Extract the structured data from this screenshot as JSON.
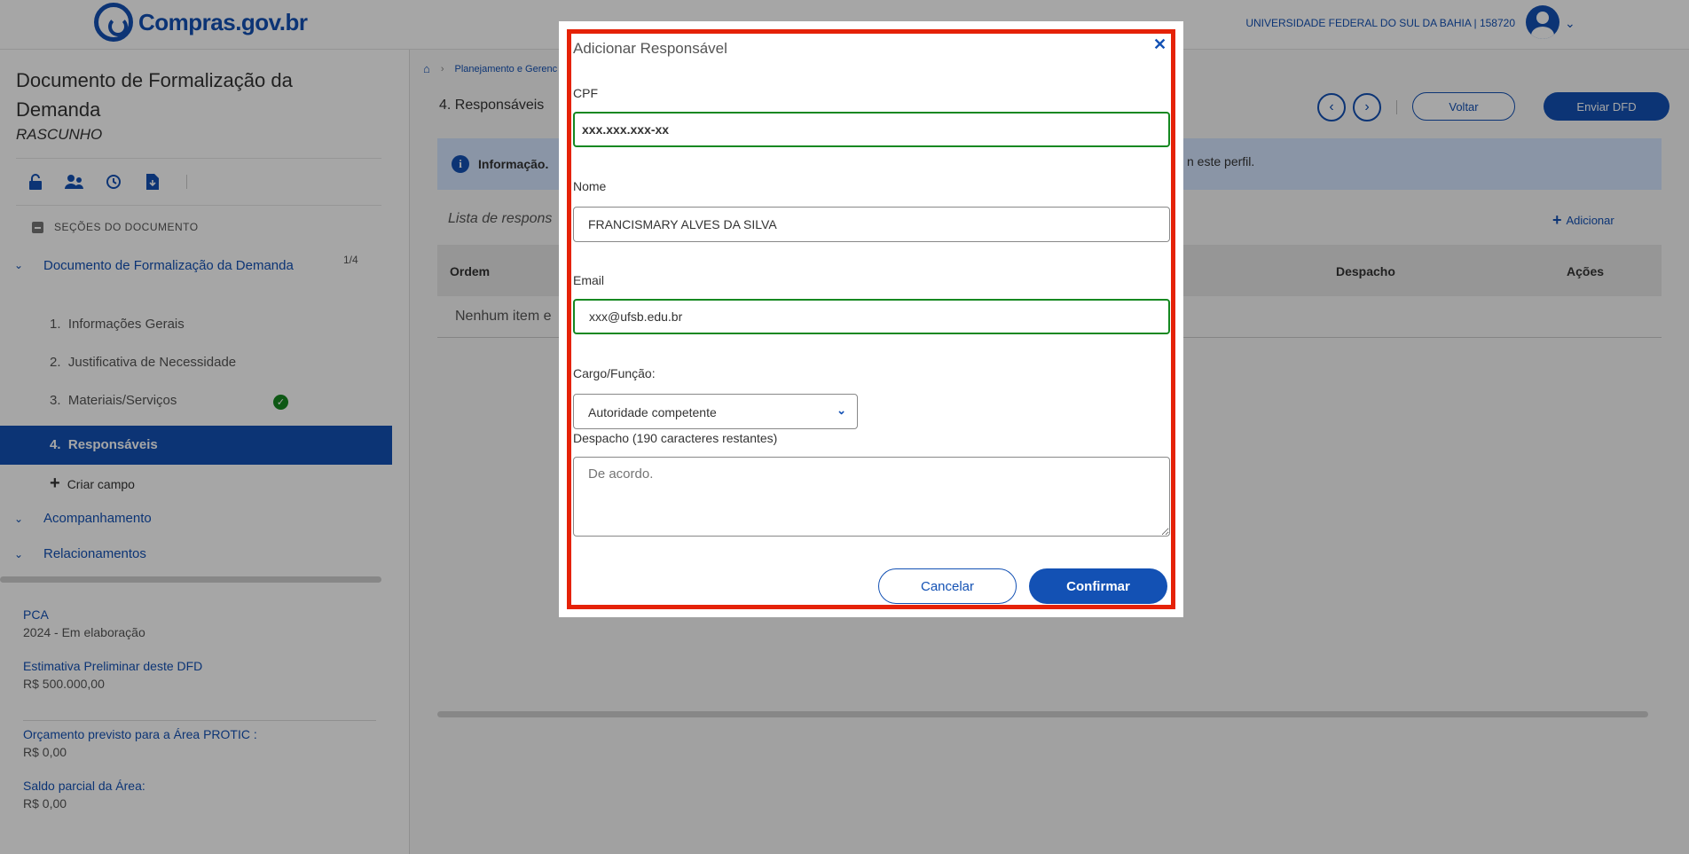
{
  "header": {
    "logo_text": "Compras.gov.br",
    "organization": "UNIVERSIDADE FEDERAL DO SUL DA BAHIA | 158720"
  },
  "sidebar": {
    "title": "Documento de Formalização da Demanda",
    "status": "RASCUNHO",
    "section_label": "SEÇÕES DO DOCUMENTO",
    "group_main": "Documento de Formalização da Demanda",
    "group_count": "1/4",
    "items": [
      {
        "num": "1.",
        "label": "Informações Gerais"
      },
      {
        "num": "2.",
        "label": "Justificativa de Necessidade"
      },
      {
        "num": "3.",
        "label": "Materiais/Serviços"
      },
      {
        "num": "4.",
        "label": "Responsáveis"
      }
    ],
    "add_field": "Criar campo",
    "group_tracking": "Acompanhamento",
    "group_relations": "Relacionamentos",
    "info": [
      {
        "label": "PCA",
        "value": "2024 - Em elaboração"
      },
      {
        "label": "Estimativa Preliminar deste DFD",
        "value": "R$ 500.000,00"
      },
      {
        "label": "Orçamento previsto para a Área PROTIC :",
        "value": "R$ 0,00"
      },
      {
        "label": "Saldo parcial da Área:",
        "value": "R$ 0,00"
      }
    ]
  },
  "main": {
    "breadcrumb": "Planejamento e Gerenc",
    "step_title": "4. Responsáveis",
    "back_button": "Voltar",
    "send_button": "Enviar DFD",
    "banner_label": "Informação.",
    "banner_tail": "n este perfil.",
    "list_title": "Lista de respons",
    "add_link": "Adicionar",
    "table": {
      "headers": {
        "order": "Ordem",
        "dispatch": "Despacho",
        "actions": "Ações"
      },
      "empty": "Nenhum item e"
    }
  },
  "modal": {
    "title": "Adicionar Responsável",
    "cpf_label": "CPF",
    "cpf_value": "xxx.xxx.xxx-xx",
    "name_label": "Nome",
    "name_value": "FRANCISMARY ALVES DA SILVA",
    "email_label": "Email",
    "email_value": "xxx@ufsb.edu.br",
    "role_label": "Cargo/Função:",
    "role_value": "Autoridade competente",
    "dispatch_label": "Despacho (190 caracteres restantes)",
    "dispatch_value": "De acordo.",
    "cancel_button": "Cancelar",
    "confirm_button": "Confirmar"
  },
  "colors": {
    "primary": "#1351b4",
    "success": "#168821",
    "highlight": "#e52207",
    "info_bg": "#d4e5ff"
  }
}
